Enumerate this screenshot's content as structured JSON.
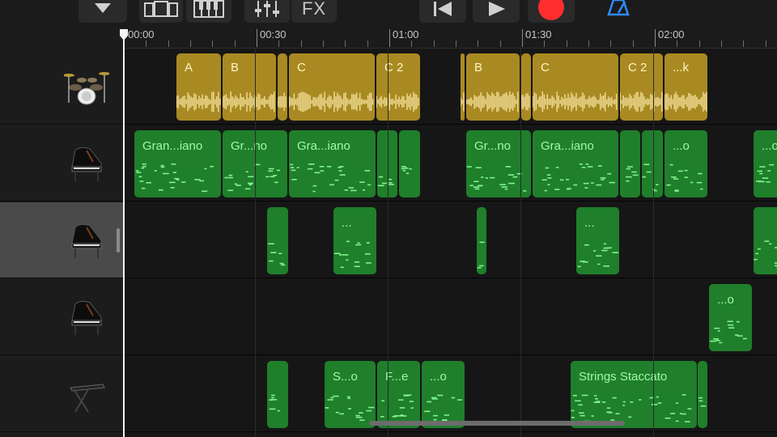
{
  "toolbar": {
    "fx_label": "FX",
    "icons": [
      "chevron-down-icon",
      "track-view-icon",
      "keyboard-icon",
      "mixer-icon",
      "fx-icon",
      "rewind-icon",
      "play-icon",
      "record-icon",
      "metronome-icon"
    ],
    "colors": {
      "record": "#ff2d2d",
      "metronome": "#2f8cff"
    }
  },
  "ruler": {
    "labels": [
      "00:00",
      "00:30",
      "01:00",
      "01:30",
      "02:00"
    ]
  },
  "tracks": [
    {
      "instrument_icon": "drum-kit-icon",
      "kind": "audio",
      "selected": false,
      "regions": [
        {
          "name": "A"
        },
        {
          "name": "B"
        },
        {
          "name": ""
        },
        {
          "name": "C"
        },
        {
          "name": "C 2"
        },
        {
          "name": ""
        },
        {
          "name": "B"
        },
        {
          "name": ""
        },
        {
          "name": "C"
        },
        {
          "name": "C 2"
        },
        {
          "name": "...k"
        }
      ]
    },
    {
      "instrument_icon": "grand-piano-icon",
      "kind": "midi",
      "selected": false,
      "regions": [
        {
          "name": "Gran...iano"
        },
        {
          "name": "Gr...no"
        },
        {
          "name": "Gra...iano"
        },
        {
          "name": ""
        },
        {
          "name": ""
        },
        {
          "name": "Gr...no"
        },
        {
          "name": "Gra...iano"
        },
        {
          "name": ""
        },
        {
          "name": ""
        },
        {
          "name": "...o"
        },
        {
          "name": "...o"
        }
      ]
    },
    {
      "instrument_icon": "grand-piano-icon",
      "kind": "midi",
      "selected": true,
      "regions": [
        {
          "name": ""
        },
        {
          "name": "..."
        },
        {
          "name": ""
        },
        {
          "name": "..."
        },
        {
          "name": ""
        }
      ]
    },
    {
      "instrument_icon": "grand-piano-icon",
      "kind": "midi",
      "selected": false,
      "regions": [
        {
          "name": "...o"
        }
      ]
    },
    {
      "instrument_icon": "synth-keyboard-icon",
      "kind": "midi",
      "selected": false,
      "regions": [
        {
          "name": ""
        },
        {
          "name": "S...o"
        },
        {
          "name": "F...e"
        },
        {
          "name": "...o"
        },
        {
          "name": "Strings Staccato"
        },
        {
          "name": ""
        }
      ]
    }
  ],
  "colors": {
    "audio_region": "#a98a22",
    "midi_region": "#1f7f2b",
    "midi_text": "#a4f7a6",
    "audio_text": "#fff3c4"
  }
}
